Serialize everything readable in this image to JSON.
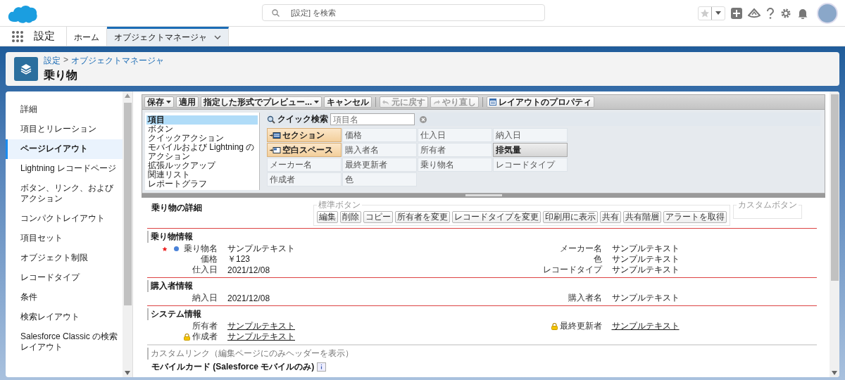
{
  "top_bar": {
    "search": {
      "placeholder": "[設定] を検索"
    }
  },
  "nav": {
    "app_name": "設定",
    "tabs": [
      {
        "label": "ホーム",
        "selected": false
      },
      {
        "label": "オブジェクトマネージャ",
        "selected": true
      }
    ]
  },
  "page_header": {
    "breadcrumb": [
      "設定",
      "オブジェクトマネージャ"
    ],
    "separator": ">",
    "title": "乗り物"
  },
  "sidebar": {
    "items": [
      {
        "label": "詳細",
        "selected": false
      },
      {
        "label": "項目とリレーション",
        "selected": false
      },
      {
        "label": "ページレイアウト",
        "selected": true
      },
      {
        "label": "Lightning レコードページ",
        "selected": false
      },
      {
        "label": "ボタン、リンク、およびアクション",
        "selected": false
      },
      {
        "label": "コンパクトレイアウト",
        "selected": false
      },
      {
        "label": "項目セット",
        "selected": false
      },
      {
        "label": "オブジェクト制限",
        "selected": false
      },
      {
        "label": "レコードタイプ",
        "selected": false
      },
      {
        "label": "条件",
        "selected": false
      },
      {
        "label": "検索レイアウト",
        "selected": false
      },
      {
        "label": "Salesforce Classic の検索レイアウト",
        "selected": false
      }
    ]
  },
  "toolbar": {
    "buttons": [
      {
        "label": "保存",
        "kind": "split",
        "disabled": false
      },
      {
        "label": "適用",
        "kind": "plain",
        "disabled": false
      },
      {
        "label": "指定した形式でプレビュー...",
        "kind": "dropdown",
        "disabled": false
      },
      {
        "label": "キャンセル",
        "kind": "plain",
        "disabled": false
      },
      {
        "label": "元に戻す",
        "kind": "undo",
        "disabled": true
      },
      {
        "label": "やり直し",
        "kind": "redo",
        "disabled": true
      },
      {
        "label": "レイアウトのプロパティ",
        "kind": "properties",
        "disabled": false
      }
    ]
  },
  "palette": {
    "categories": [
      {
        "label": "項目",
        "selected": true
      },
      {
        "label": "ボタン",
        "selected": false
      },
      {
        "label": "クイックアクション",
        "selected": false
      },
      {
        "label": "モバイルおよび Lightning のアクション",
        "selected": false
      },
      {
        "label": "拡張ルックアップ",
        "selected": false
      },
      {
        "label": "関連リスト",
        "selected": false
      },
      {
        "label": "レポートグラフ",
        "selected": false
      }
    ],
    "quick_search": {
      "label": "クイック検索",
      "placeholder": "項目名"
    },
    "items": [
      {
        "label": "セクション",
        "kind": "section"
      },
      {
        "label": "価格",
        "kind": "field",
        "placed": true
      },
      {
        "label": "仕入日",
        "kind": "field",
        "placed": true
      },
      {
        "label": "納入日",
        "kind": "field",
        "placed": true
      },
      {
        "label": "空白スペース",
        "kind": "blank"
      },
      {
        "label": "購入者名",
        "kind": "field",
        "placed": true
      },
      {
        "label": "所有者",
        "kind": "field",
        "placed": true
      },
      {
        "label": "排気量",
        "kind": "field",
        "placed": false
      },
      {
        "label": "メーカー名",
        "kind": "field",
        "placed": true
      },
      {
        "label": "最終更新者",
        "kind": "field",
        "placed": true
      },
      {
        "label": "乗り物名",
        "kind": "field",
        "placed": true
      },
      {
        "label": "レコードタイプ",
        "kind": "field",
        "placed": true
      },
      {
        "label": "作成者",
        "kind": "field",
        "placed": true
      },
      {
        "label": "色",
        "kind": "field",
        "placed": true
      }
    ]
  },
  "preview": {
    "title": "乗り物の詳細",
    "standard_buttons": {
      "legend": "標準ボタン",
      "buttons": [
        "編集",
        "削除",
        "コピー",
        "所有者を変更",
        "レコードタイプを変更",
        "印刷用に表示",
        "共有",
        "共有階層",
        "アラートを取得"
      ]
    },
    "custom_buttons": {
      "legend": "カスタムボタン"
    },
    "sections": [
      {
        "kind": "fields",
        "title": "乗り物情報",
        "left": [
          {
            "label": "乗り物名",
            "value": "サンプルテキスト",
            "required": true,
            "dot": true,
            "locked": false,
            "link": false
          },
          {
            "label": "価格",
            "value": "￥123",
            "required": false,
            "dot": false,
            "locked": false,
            "link": false
          },
          {
            "label": "仕入日",
            "value": "2021/12/08",
            "required": false,
            "dot": false,
            "locked": false,
            "link": false
          }
        ],
        "right": [
          {
            "label": "メーカー名",
            "value": "サンプルテキスト",
            "required": false,
            "dot": false,
            "locked": false,
            "link": false
          },
          {
            "label": "色",
            "value": "サンプルテキスト",
            "required": false,
            "dot": false,
            "locked": false,
            "link": false
          },
          {
            "label": "レコードタイプ",
            "value": "サンプルテキスト",
            "required": false,
            "dot": false,
            "locked": false,
            "link": false
          }
        ]
      },
      {
        "kind": "fields",
        "title": "購入者情報",
        "left": [
          {
            "label": "納入日",
            "value": "2021/12/08",
            "required": false,
            "dot": false,
            "locked": false,
            "link": false
          }
        ],
        "right": [
          {
            "label": "購入者名",
            "value": "サンプルテキスト",
            "required": false,
            "dot": false,
            "locked": false,
            "link": false
          }
        ]
      },
      {
        "kind": "fields",
        "title": "システム情報",
        "left": [
          {
            "label": "所有者",
            "value": "サンプルテキスト",
            "required": false,
            "dot": false,
            "locked": false,
            "link": true
          },
          {
            "label": "作成者",
            "value": "サンプルテキスト",
            "required": false,
            "dot": false,
            "locked": true,
            "link": true
          }
        ],
        "right": [
          {
            "label": "最終更新者",
            "value": "サンプルテキスト",
            "required": false,
            "dot": false,
            "locked": true,
            "link": true
          }
        ]
      },
      {
        "kind": "links",
        "title": "カスタムリンク（編集ページにのみヘッダーを表示）"
      }
    ],
    "mobile_cards": {
      "title": "モバイルカード (Salesforce モバイルのみ)"
    }
  }
}
